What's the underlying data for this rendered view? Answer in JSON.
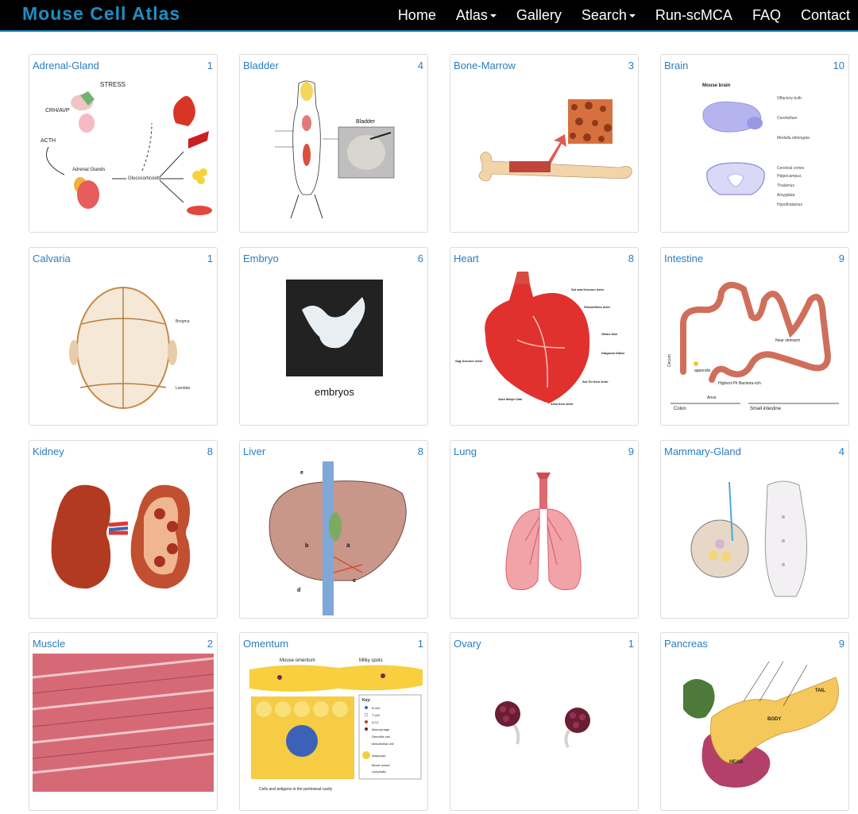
{
  "brand": "Mouse Cell Atlas",
  "nav": [
    {
      "label": "Home",
      "dropdown": false
    },
    {
      "label": "Atlas",
      "dropdown": true
    },
    {
      "label": "Gallery",
      "dropdown": false
    },
    {
      "label": "Search",
      "dropdown": true
    },
    {
      "label": "Run-scMCA",
      "dropdown": false
    },
    {
      "label": "FAQ",
      "dropdown": false
    },
    {
      "label": "Contact",
      "dropdown": false
    }
  ],
  "tissues": [
    {
      "name": "Adrenal-Gland",
      "count": "1",
      "img_labels": [
        "STRESS",
        "CRH/AVP",
        "ACTH",
        "Adrenal Glands",
        "Glucocorticoids"
      ]
    },
    {
      "name": "Bladder",
      "count": "4",
      "img_labels": [
        "Bladder"
      ]
    },
    {
      "name": "Bone-Marrow",
      "count": "3",
      "img_labels": []
    },
    {
      "name": "Brain",
      "count": "10",
      "img_labels": [
        "Mouse brain",
        "Olfactory bulb",
        "Cerebellum",
        "Medulla oblongata",
        "Cerebral cortex",
        "Hippocampus",
        "Thalamus",
        "Amygdala",
        "Hypothalamus"
      ]
    },
    {
      "name": "Calvaria",
      "count": "1",
      "img_labels": [
        "Bregma",
        "Lambda"
      ]
    },
    {
      "name": "Embryo",
      "count": "6",
      "img_labels": [
        "embryos"
      ]
    },
    {
      "name": "Heart",
      "count": "8",
      "img_labels": [
        "Sol ana Koroner Arter",
        "Sirkumfleks Arter",
        "Obtus Dalı",
        "Diagonal Dallar",
        "Sağ Koroner Arter",
        "Sol Ön İnen Arter",
        "Akut Marjin Dalı",
        "Arka İnen Arter"
      ]
    },
    {
      "name": "Intestine",
      "count": "9",
      "img_labels": [
        "Cecum",
        "appendix",
        "Highest Ph Bacteria-rich",
        "Anus",
        "Near stomach",
        "Colon",
        "Small intestine"
      ]
    },
    {
      "name": "Kidney",
      "count": "8",
      "img_labels": []
    },
    {
      "name": "Liver",
      "count": "8",
      "img_labels": [
        "e",
        "a",
        "b",
        "c",
        "d"
      ]
    },
    {
      "name": "Lung",
      "count": "9",
      "img_labels": []
    },
    {
      "name": "Mammary-Gland",
      "count": "4",
      "img_labels": []
    },
    {
      "name": "Muscle",
      "count": "2",
      "img_labels": []
    },
    {
      "name": "Omentum",
      "count": "1",
      "img_labels": [
        "Mouse omentum",
        "Milky spots",
        "Key:",
        "B cell",
        "T cell",
        "ILC2",
        "Macrophage",
        "Dendritic cell",
        "Mesothelial cell",
        "Adipocyte",
        "Blood vessel",
        "Lymphatic",
        "Cells and antigens in the peritoneal cavity"
      ]
    },
    {
      "name": "Ovary",
      "count": "1",
      "img_labels": []
    },
    {
      "name": "Pancreas",
      "count": "9",
      "img_labels": [
        "TAIL",
        "BODY",
        "HEAD"
      ]
    }
  ]
}
